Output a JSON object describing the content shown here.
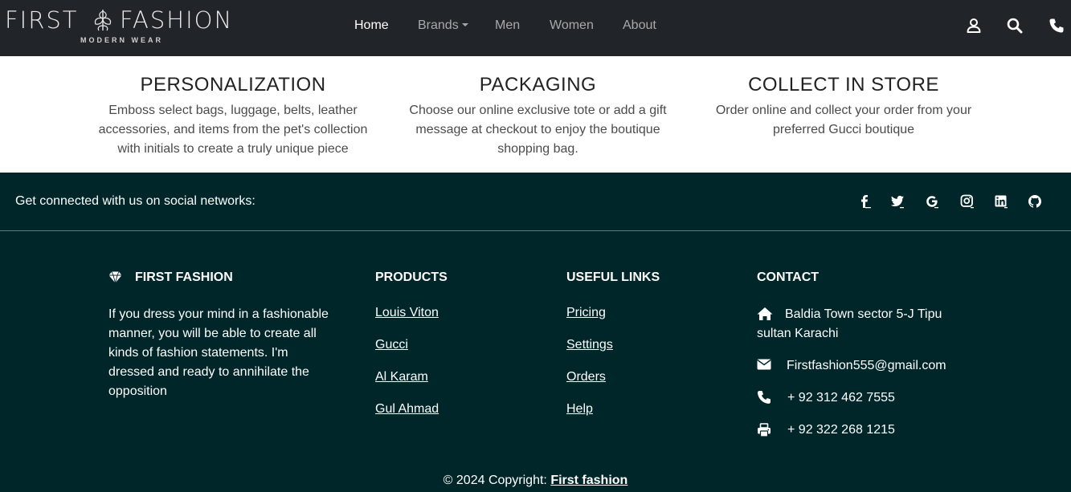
{
  "navbar": {
    "brand_word1": "FIRST",
    "brand_word2": "FASHION",
    "brand_sub": "MODERN WEAR",
    "links": [
      "Home",
      "Brands",
      "Men",
      "Women",
      "About"
    ],
    "active": "Home",
    "icons": [
      "user-icon",
      "search-icon",
      "phone-icon"
    ]
  },
  "features": [
    {
      "title": "PERSONALIZATION",
      "text": "Emboss select bags, luggage, belts, leather accessories, and items from the pet's collection with initials to create a truly unique piece"
    },
    {
      "title": "PACKAGING",
      "text": "Choose our online exclusive tote or add a gift message at checkout to enjoy the boutique shopping bag."
    },
    {
      "title": "COLLECT IN STORE",
      "text": "Order online and collect your order from your preferred Gucci boutique"
    }
  ],
  "social": {
    "text": "Get connected with us on social networks:",
    "icons": [
      "facebook-icon",
      "twitter-icon",
      "google-icon",
      "instagram-icon",
      "linkedin-icon",
      "github-icon"
    ]
  },
  "footer": {
    "about_title": "FIRST FASHION",
    "about_text": "If you dress your mind in a fashionable manner, you will be able to create all kinds of fashion statements. I'm dressed and ready to annihilate the opposition",
    "products_title": "PRODUCTS",
    "products": [
      "Louis Viton",
      "Gucci",
      "Al Karam",
      "Gul Ahmad"
    ],
    "links_title": "USEFUL LINKS",
    "links": [
      "Pricing",
      "Settings",
      "Orders",
      "Help"
    ],
    "contact_title": "CONTACT",
    "address": "Baldia Town sector 5-J Tipu sultan Karachi",
    "email": "Firstfashion555@gmail.com",
    "phone": "+ 92 312 462 7555",
    "fax": "+ 92 322 268 1215",
    "copyright_prefix": "© 2024 Copyright: ",
    "copyright_link": "First fashion"
  },
  "colors": {
    "navbar_bg": "#212529",
    "footer_bg": "#002629"
  }
}
